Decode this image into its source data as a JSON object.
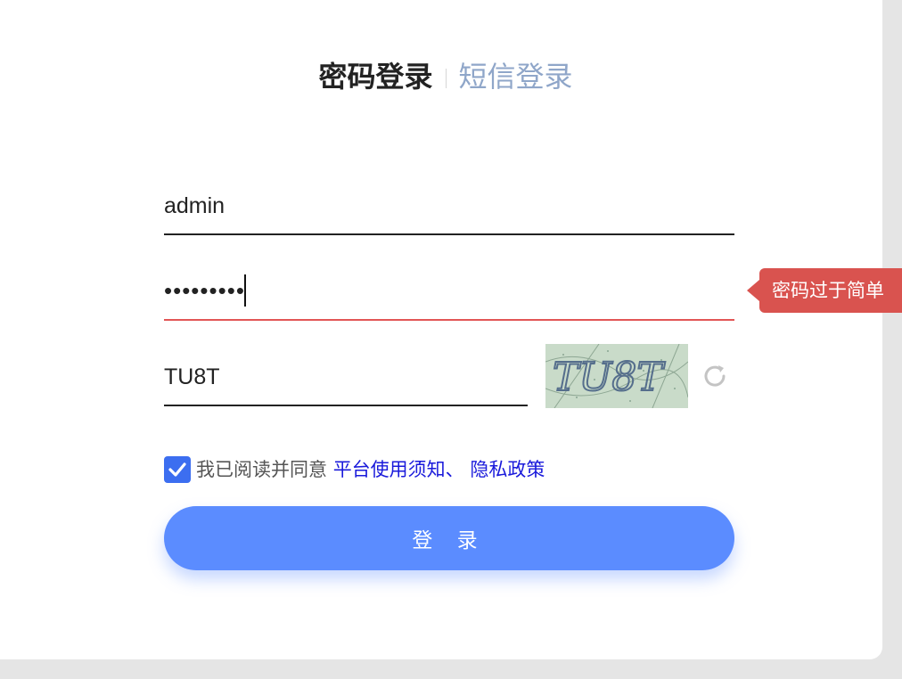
{
  "tabs": {
    "active_label": "密码登录",
    "inactive_label": "短信登录"
  },
  "username": {
    "value": "admin"
  },
  "password": {
    "value": "•••••••••"
  },
  "captcha": {
    "value": "TU8T",
    "image_text": "TU8T"
  },
  "validation": {
    "tooltip": "密码过于简单"
  },
  "agreement": {
    "checked": true,
    "text": "我已阅读并同意",
    "link_terms": "平台使用须知、",
    "link_privacy": "隐私政策"
  },
  "login_button": {
    "label": "登 录"
  },
  "colors": {
    "accent": "#5b8cff",
    "error": "#d9534f",
    "checkbox": "#3c6ef0",
    "inactive_tab": "#8fa6c9"
  },
  "icons": {
    "refresh": "refresh-icon",
    "check": "check-icon"
  }
}
